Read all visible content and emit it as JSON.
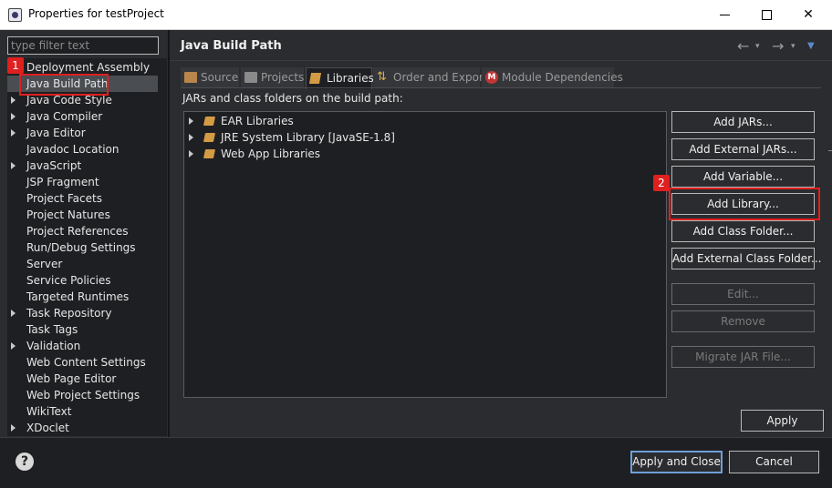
{
  "window": {
    "title": "Properties for testProject",
    "minimize_label": "",
    "close_label": "✕"
  },
  "filter": {
    "placeholder": "type filter text"
  },
  "sidebar": {
    "items": [
      {
        "label": "Deployment Assembly",
        "expandable": false
      },
      {
        "label": "Java Build Path",
        "expandable": false,
        "selected": true
      },
      {
        "label": "Java Code Style",
        "expandable": true
      },
      {
        "label": "Java Compiler",
        "expandable": true
      },
      {
        "label": "Java Editor",
        "expandable": true
      },
      {
        "label": "Javadoc Location",
        "expandable": false
      },
      {
        "label": "JavaScript",
        "expandable": true
      },
      {
        "label": "JSP Fragment",
        "expandable": false
      },
      {
        "label": "Project Facets",
        "expandable": false
      },
      {
        "label": "Project Natures",
        "expandable": false
      },
      {
        "label": "Project References",
        "expandable": false
      },
      {
        "label": "Run/Debug Settings",
        "expandable": false
      },
      {
        "label": "Server",
        "expandable": false
      },
      {
        "label": "Service Policies",
        "expandable": false
      },
      {
        "label": "Targeted Runtimes",
        "expandable": false
      },
      {
        "label": "Task Repository",
        "expandable": true
      },
      {
        "label": "Task Tags",
        "expandable": false
      },
      {
        "label": "Validation",
        "expandable": true
      },
      {
        "label": "Web Content Settings",
        "expandable": false
      },
      {
        "label": "Web Page Editor",
        "expandable": false
      },
      {
        "label": "Web Project Settings",
        "expandable": false
      },
      {
        "label": "WikiText",
        "expandable": false
      },
      {
        "label": "XDoclet",
        "expandable": true
      }
    ]
  },
  "main": {
    "title": "Java Build Path",
    "tabs": [
      {
        "label": "Source",
        "icon": "source-folder-icon"
      },
      {
        "label": "Projects",
        "icon": "projects-folder-icon"
      },
      {
        "label": "Libraries",
        "icon": "library-icon",
        "active": true
      },
      {
        "label": "Order and Export",
        "icon": "order-export-icon"
      },
      {
        "label": "Module Dependencies",
        "icon": "module-icon",
        "icon_text": "M"
      }
    ],
    "section_label": "JARs and class folders on the build path:",
    "libraries": [
      {
        "label": "EAR Libraries"
      },
      {
        "label": "JRE System Library [JavaSE-1.8]"
      },
      {
        "label": "Web App Libraries"
      }
    ],
    "buttons": {
      "add_jars": "Add JARs...",
      "add_external_jars": "Add External JARs...",
      "add_variable": "Add Variable...",
      "add_library": "Add Library...",
      "add_class_folder": "Add Class Folder...",
      "add_external_class_folder": "Add External Class Folder...",
      "edit": "Edit...",
      "remove": "Remove",
      "migrate_jar": "Migrate JAR File...",
      "apply": "Apply"
    }
  },
  "footer": {
    "help_label": "?",
    "apply_and_close": "Apply and Close",
    "cancel": "Cancel"
  },
  "annotations": {
    "callout_1": "1",
    "callout_2": "2",
    "color": "#e01f1f"
  },
  "colors": {
    "background": "#1e1f22",
    "panel": "#2b2c2f",
    "selection": "#4a4d52",
    "default_button_border": "#6ea0d8"
  }
}
